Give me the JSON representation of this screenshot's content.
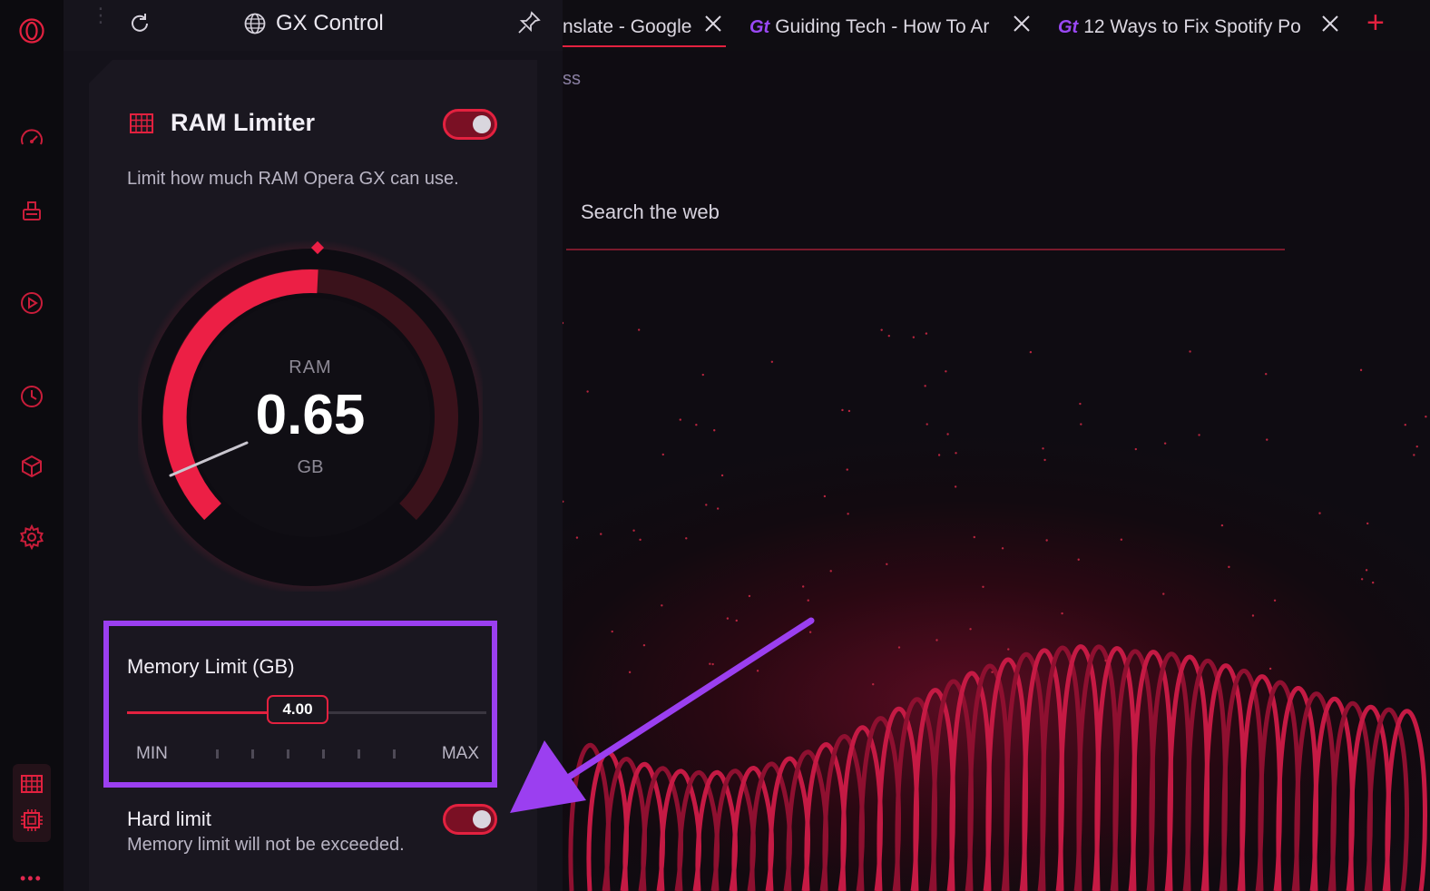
{
  "sidebar": {
    "icons": [
      "opera-logo-icon",
      "speed-dial-icon",
      "cleaner-icon",
      "player-icon",
      "history-icon",
      "extensions-icon",
      "settings-icon",
      "ram-limiter-icon",
      "cpu-limiter-icon",
      "more-icon"
    ]
  },
  "panel": {
    "header": {
      "title": "GX Control"
    },
    "ram_limiter": {
      "title": "RAM Limiter",
      "enabled": true,
      "description": "Limit how much RAM Opera GX can use.",
      "gauge": {
        "label": "RAM",
        "value": "0.65",
        "unit": "GB"
      },
      "memory_limit": {
        "title": "Memory Limit (GB)",
        "value": "4.00",
        "fraction": 0.39,
        "min_label": "MIN",
        "max_label": "MAX"
      },
      "hard_limit": {
        "title": "Hard limit",
        "description": "Memory limit will not be exceeded.",
        "enabled": true
      }
    }
  },
  "tabs": [
    {
      "label": "nslate - Google"
    },
    {
      "label": "Guiding Tech - How To Ar",
      "favicon": "Gt"
    },
    {
      "label": "12 Ways to Fix Spotify Po",
      "favicon": "Gt"
    }
  ],
  "page": {
    "crumb": "ss",
    "search_placeholder": "Search the web"
  },
  "colors": {
    "accent": "#e3213f",
    "highlight": "#9b3ff0",
    "panel_bg": "#14121a"
  }
}
